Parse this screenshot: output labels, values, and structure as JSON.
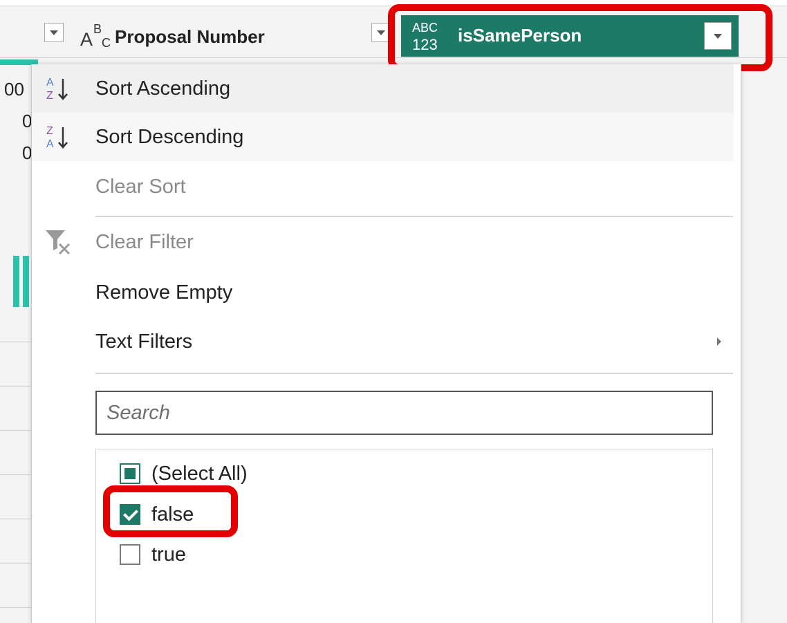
{
  "header": {
    "left_fragment": "00",
    "column_proposal": {
      "type_icon": "text-type-icon",
      "name": "Proposal Number"
    },
    "column_selected": {
      "type_icon": "any-type-icon",
      "name": "isSamePerson",
      "color": "#1d7a66"
    }
  },
  "row_fragments": [
    "0",
    "0"
  ],
  "menu": {
    "sort_ascending": "Sort Ascending",
    "sort_descending": "Sort Descending",
    "clear_sort": "Clear Sort",
    "clear_filter": "Clear Filter",
    "remove_empty": "Remove Empty",
    "text_filters": "Text Filters"
  },
  "search": {
    "placeholder": "Search",
    "value": ""
  },
  "filter_values": [
    {
      "label": "(Select All)",
      "state": "partial"
    },
    {
      "label": "false",
      "state": "checked"
    },
    {
      "label": "true",
      "state": "unchecked"
    }
  ],
  "highlight_color": "#e30000"
}
